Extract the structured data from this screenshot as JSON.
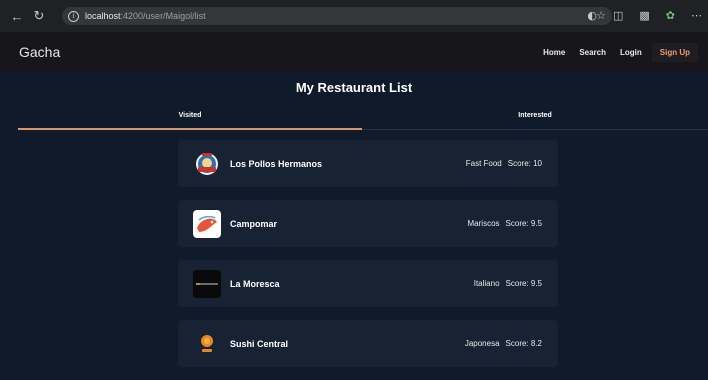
{
  "browser": {
    "url_host": "localhost",
    "url_path": ":4200/user/Maigol/list"
  },
  "app": {
    "brand": "Gacha",
    "menu": {
      "home": "Home",
      "search": "Search",
      "login": "Login",
      "signup": "Sign Up"
    }
  },
  "page": {
    "title": "My Restaurant List",
    "tabs": [
      {
        "label": "Visited",
        "active": true
      },
      {
        "label": "Interested",
        "active": false
      }
    ]
  },
  "restaurants": [
    {
      "name": "Los Pollos Hermanos",
      "category": "Fast Food",
      "score": "Score: 10",
      "logo": "pollos-logo"
    },
    {
      "name": "Campomar",
      "category": "Mariscos",
      "score": "Score: 9.5",
      "logo": "campomar-logo"
    },
    {
      "name": "La Moresca",
      "category": "Italiano",
      "score": "Score: 9.5",
      "logo": "moresca-logo"
    },
    {
      "name": "Sushi Central",
      "category": "Japonesa",
      "score": "Score: 8.2",
      "logo": "sushi-logo"
    }
  ],
  "colors": {
    "accent": "#d99565",
    "background": "#0f1a2a",
    "card": "#172233",
    "header": "#17161a"
  }
}
